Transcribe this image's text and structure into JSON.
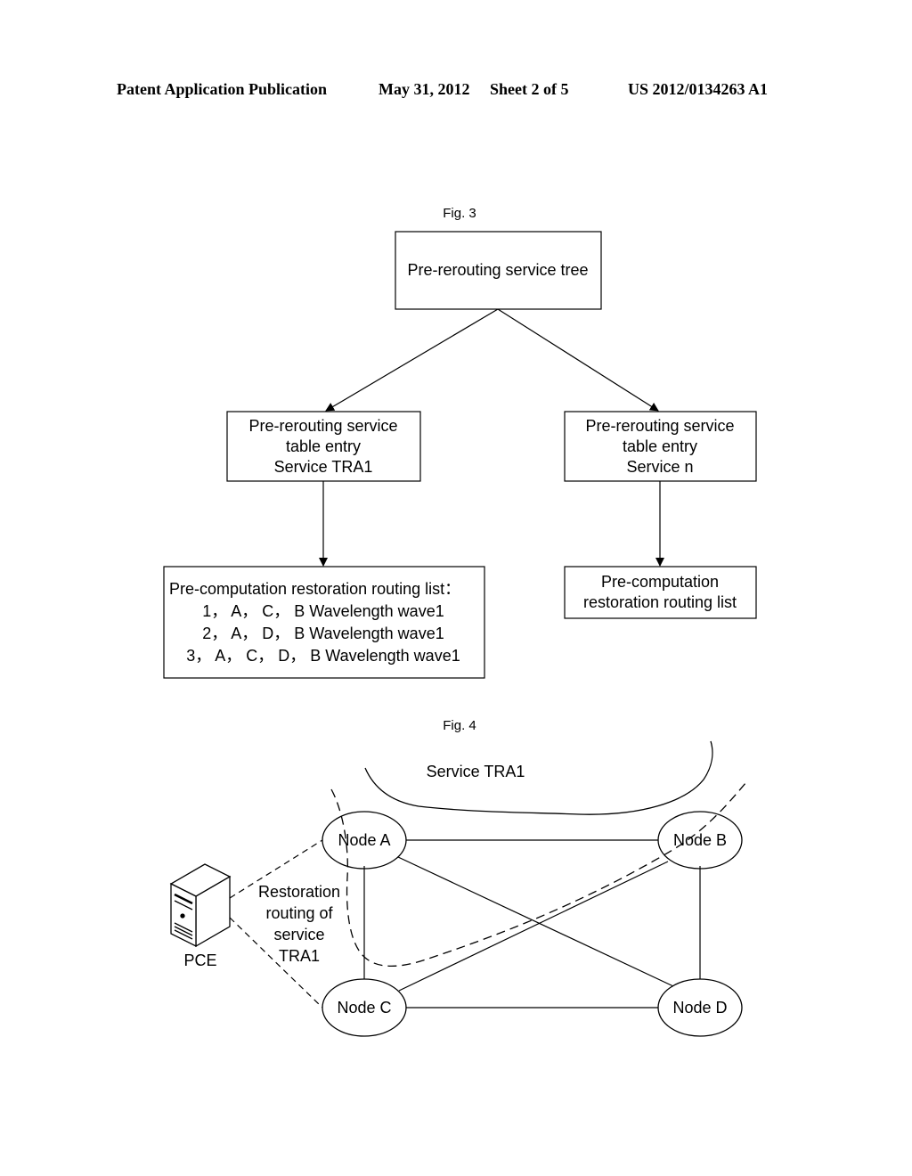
{
  "header": {
    "publication": "Patent Application Publication",
    "date": "May 31, 2012",
    "sheet": "Sheet 2 of 5",
    "number": "US 2012/0134263 A1"
  },
  "fig3": {
    "caption": "Fig. 3",
    "root": "Pre-rerouting service tree",
    "left_entry": [
      "Pre-rerouting service",
      "table entry",
      "Service TRA1"
    ],
    "right_entry": [
      "Pre-rerouting service",
      "table entry",
      "Service n"
    ],
    "left_list": [
      "Pre-computation restoration routing list：",
      "1， A， C， B Wavelength wave1",
      "2， A， D， B Wavelength wave1",
      "3， A， C， D， B Wavelength wave1"
    ],
    "right_list": [
      "Pre-computation",
      "restoration routing list"
    ]
  },
  "fig4": {
    "caption": "Fig. 4",
    "service_label": "Service TRA1",
    "nodes": {
      "a": "Node A",
      "b": "Node B",
      "c": "Node C",
      "d": "Node D"
    },
    "pce_label": "PCE",
    "restoration_label": [
      "Restoration",
      "routing of",
      "service",
      "TRA1"
    ]
  }
}
